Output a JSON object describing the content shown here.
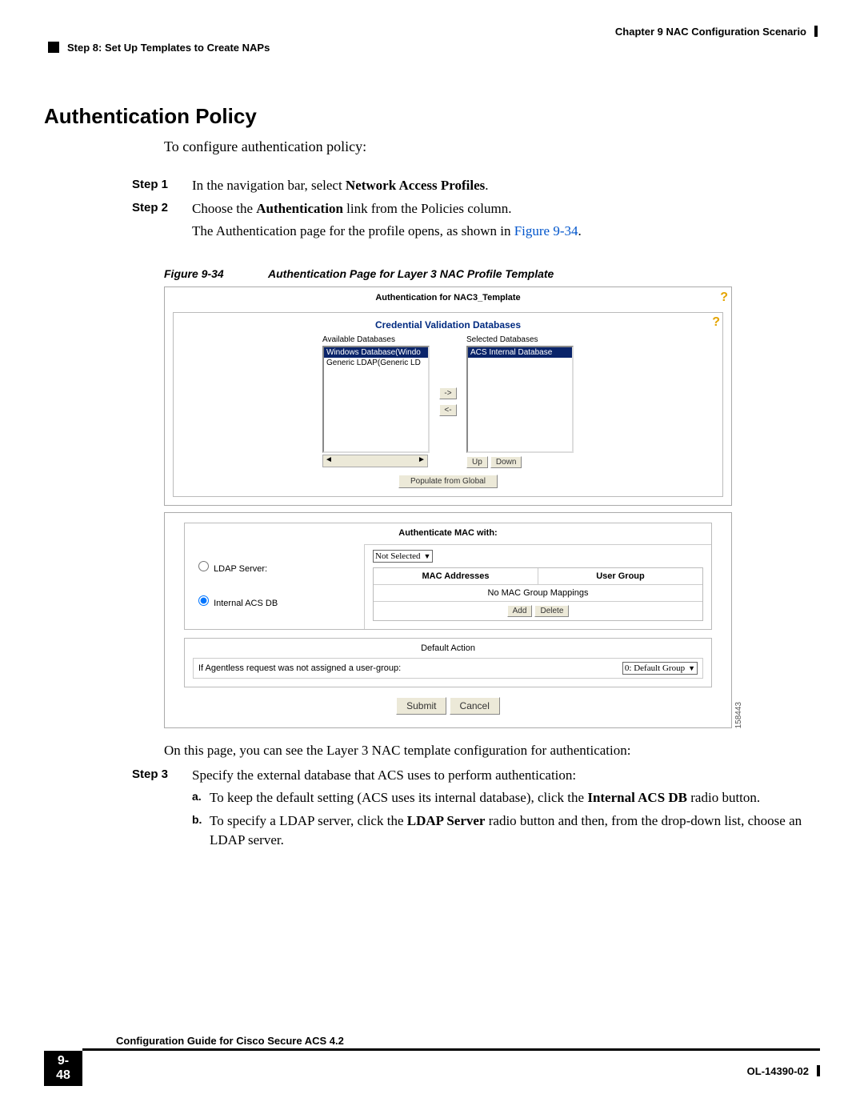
{
  "header": {
    "chapter": "Chapter 9    NAC Configuration Scenario",
    "step_title": "Step 8: Set Up Templates to Create NAPs"
  },
  "section_title": "Authentication Policy",
  "intro": "To configure authentication policy:",
  "steps": {
    "s1_label": "Step 1",
    "s1_a": "In the navigation bar, select ",
    "s1_b": "Network Access Profiles",
    "s1_c": ".",
    "s2_label": "Step 2",
    "s2_a": "Choose the ",
    "s2_b": "Authentication",
    "s2_c": " link from the Policies column.",
    "s2_followup_a": "The Authentication page for the profile opens, as shown in ",
    "s2_followup_link": "Figure 9-34",
    "s2_followup_b": "."
  },
  "figure": {
    "num": "Figure 9-34",
    "title": "Authentication Page for Layer 3 NAC Profile Template",
    "panel1_title": "Authentication for NAC3_Template",
    "cred_title": "Credential Validation Databases",
    "avail_label": "Available Databases",
    "sel_label": "Selected Databases",
    "avail_items": [
      "Windows Database(Windo",
      "Generic LDAP(Generic LD"
    ],
    "sel_items": [
      "ACS Internal Database"
    ],
    "btn_right": "->",
    "btn_left": "<-",
    "btn_up": "Up",
    "btn_down": "Down",
    "btn_populate": "Populate from Global",
    "mac_title": "Authenticate MAC with:",
    "radio_ldap": "LDAP Server:",
    "radio_internal": "Internal ACS DB",
    "ldap_sel": "Not Selected",
    "col_mac": "MAC Addresses",
    "col_grp": "User Group",
    "no_map": "No MAC Group Mappings",
    "btn_add": "Add",
    "btn_delete": "Delete",
    "def_title": "Default Action",
    "def_label": "If Agentless request was not assigned a user-group:",
    "def_sel": "0: Default Group",
    "btn_submit": "Submit",
    "btn_cancel": "Cancel",
    "side_id": "158443"
  },
  "after": {
    "p1": "On this page, you can see the Layer 3 NAC template configuration for authentication:",
    "s3_label": "Step 3",
    "s3_text": "Specify the external database that ACS uses to perform authentication:",
    "a_lbl": "a.",
    "a_a": "To keep the default setting (ACS uses its internal database), click the ",
    "a_b": "Internal ACS DB",
    "a_c": " radio button.",
    "b_lbl": "b.",
    "b_a": "To specify a LDAP server, click the ",
    "b_b": "LDAP Server",
    "b_c": " radio button and then, from the drop-down list, choose an LDAP server."
  },
  "footer": {
    "guide": "Configuration Guide for Cisco Secure ACS 4.2",
    "page": "9-48",
    "docid": "OL-14390-02"
  }
}
